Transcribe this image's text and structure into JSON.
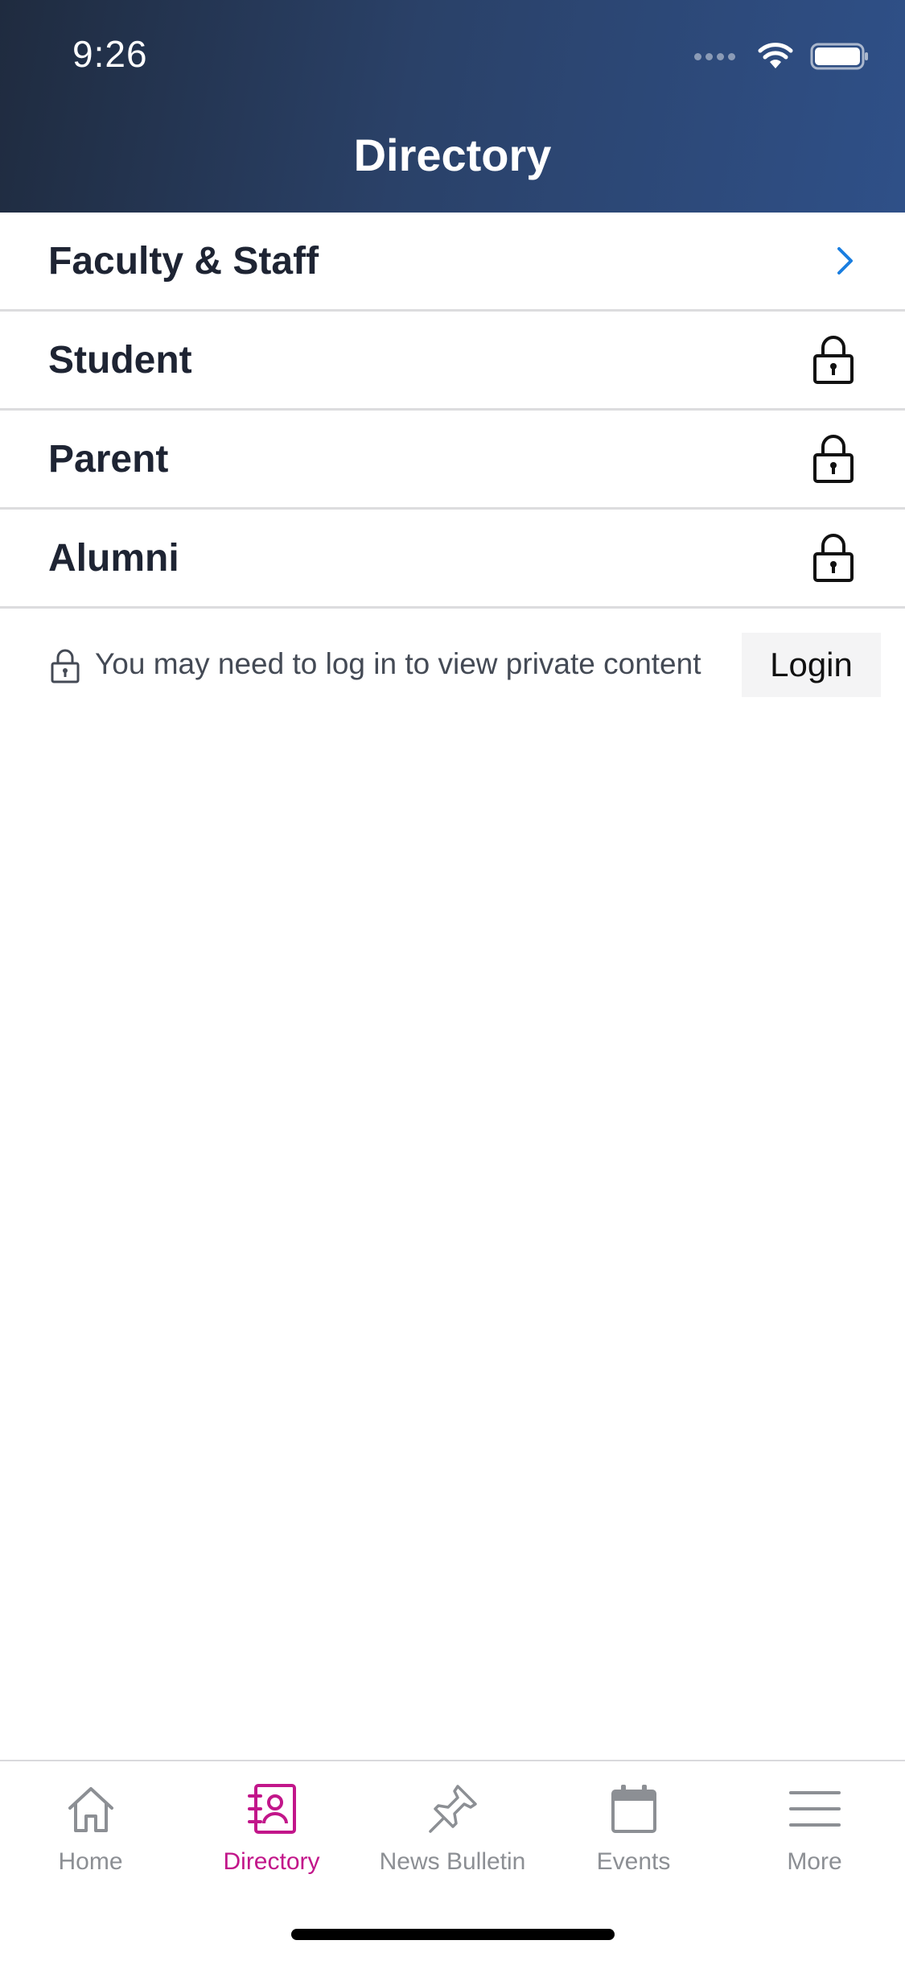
{
  "status_bar": {
    "time": "9:26"
  },
  "header": {
    "title": "Directory"
  },
  "list": {
    "items": [
      {
        "label": "Faculty & Staff",
        "icon": "chevron-right-icon"
      },
      {
        "label": "Student",
        "icon": "lock-icon"
      },
      {
        "label": "Parent",
        "icon": "lock-icon"
      },
      {
        "label": "Alumni",
        "icon": "lock-icon"
      }
    ]
  },
  "notice": {
    "text": "You may need to log in to view private content",
    "login_label": "Login"
  },
  "tabbar": {
    "tabs": [
      {
        "label": "Home",
        "icon": "home-icon",
        "active": false
      },
      {
        "label": "Directory",
        "icon": "contact-book-icon",
        "active": true
      },
      {
        "label": "News Bulletin",
        "icon": "pin-icon",
        "active": false
      },
      {
        "label": "Events",
        "icon": "calendar-icon",
        "active": false
      },
      {
        "label": "More",
        "icon": "menu-icon",
        "active": false
      }
    ]
  },
  "colors": {
    "accent": "#c2168a",
    "chevron": "#1a7ee0",
    "header_start": "#1f2b3f",
    "header_end": "#2f5088",
    "tab_inactive": "#8c8f94"
  }
}
